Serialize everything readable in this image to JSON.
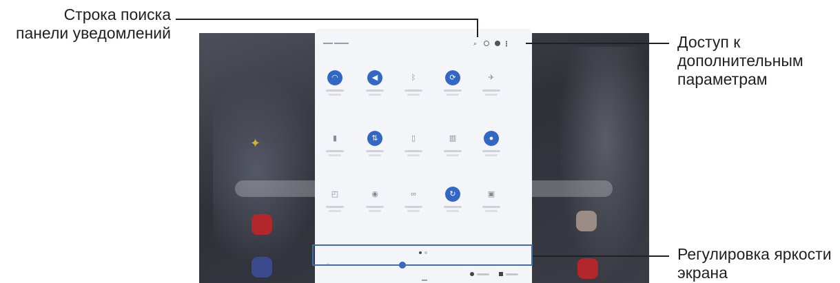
{
  "callouts": {
    "search": "Строка поиска\nпанели уведомлений",
    "more": "Доступ к\nдополнительным\nпараметрам",
    "brightness": "Регулировка яркости\nэкрана"
  },
  "panel": {
    "title_glyph": "",
    "tiles": [
      {
        "icon": "wifi-icon",
        "active": true
      },
      {
        "icon": "sound-icon",
        "active": true
      },
      {
        "icon": "bluetooth-icon",
        "active": false
      },
      {
        "icon": "auto-rotate-icon",
        "active": true
      },
      {
        "icon": "airplane-mode-icon",
        "active": false
      },
      {
        "icon": "flashlight-icon",
        "active": false
      },
      {
        "icon": "mobile-data-icon",
        "active": true
      },
      {
        "icon": "power-saving-icon",
        "active": false
      },
      {
        "icon": "mobile-hotspot-icon",
        "active": false
      },
      {
        "icon": "location-icon",
        "active": true
      },
      {
        "icon": "screenshot-icon",
        "active": false
      },
      {
        "icon": "nfc-icon",
        "active": false
      },
      {
        "icon": "smart-view-icon",
        "active": false
      },
      {
        "icon": "sync-icon",
        "active": true
      },
      {
        "icon": "screen-recorder-icon",
        "active": false
      }
    ],
    "page_indicator": {
      "count": 2,
      "active": 0
    },
    "brightness_level": 0.37
  },
  "colors": {
    "accent": "#3367c5",
    "highlight_box": "#3d6ea8",
    "panel_bg": "#f4f5f9"
  }
}
